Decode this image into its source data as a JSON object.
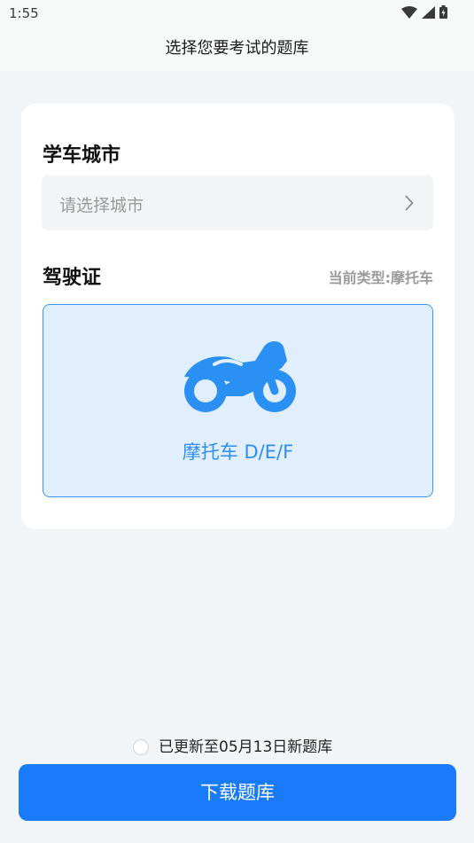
{
  "status_bar": {
    "time": "1:55",
    "icons": [
      "wifi-icon",
      "signal-icon",
      "battery-charging-icon"
    ]
  },
  "header": {
    "title": "选择您要考试的题库"
  },
  "card": {
    "city_section_title": "学车城市",
    "city_placeholder": "请选择城市",
    "license_section_title": "驾驶证",
    "current_type": "当前类型:摩托车",
    "license_option": {
      "label": "摩托车 D/E/F",
      "icon": "motorcycle-icon",
      "selected": true
    }
  },
  "footer": {
    "update_text": "已更新至05月13日新题库",
    "download_label": "下载题库"
  },
  "colors": {
    "accent": "#1a7bfa",
    "option_bg": "#e0eefe",
    "option_border": "#3d96f0",
    "page_bg": "#f2f5f8"
  }
}
